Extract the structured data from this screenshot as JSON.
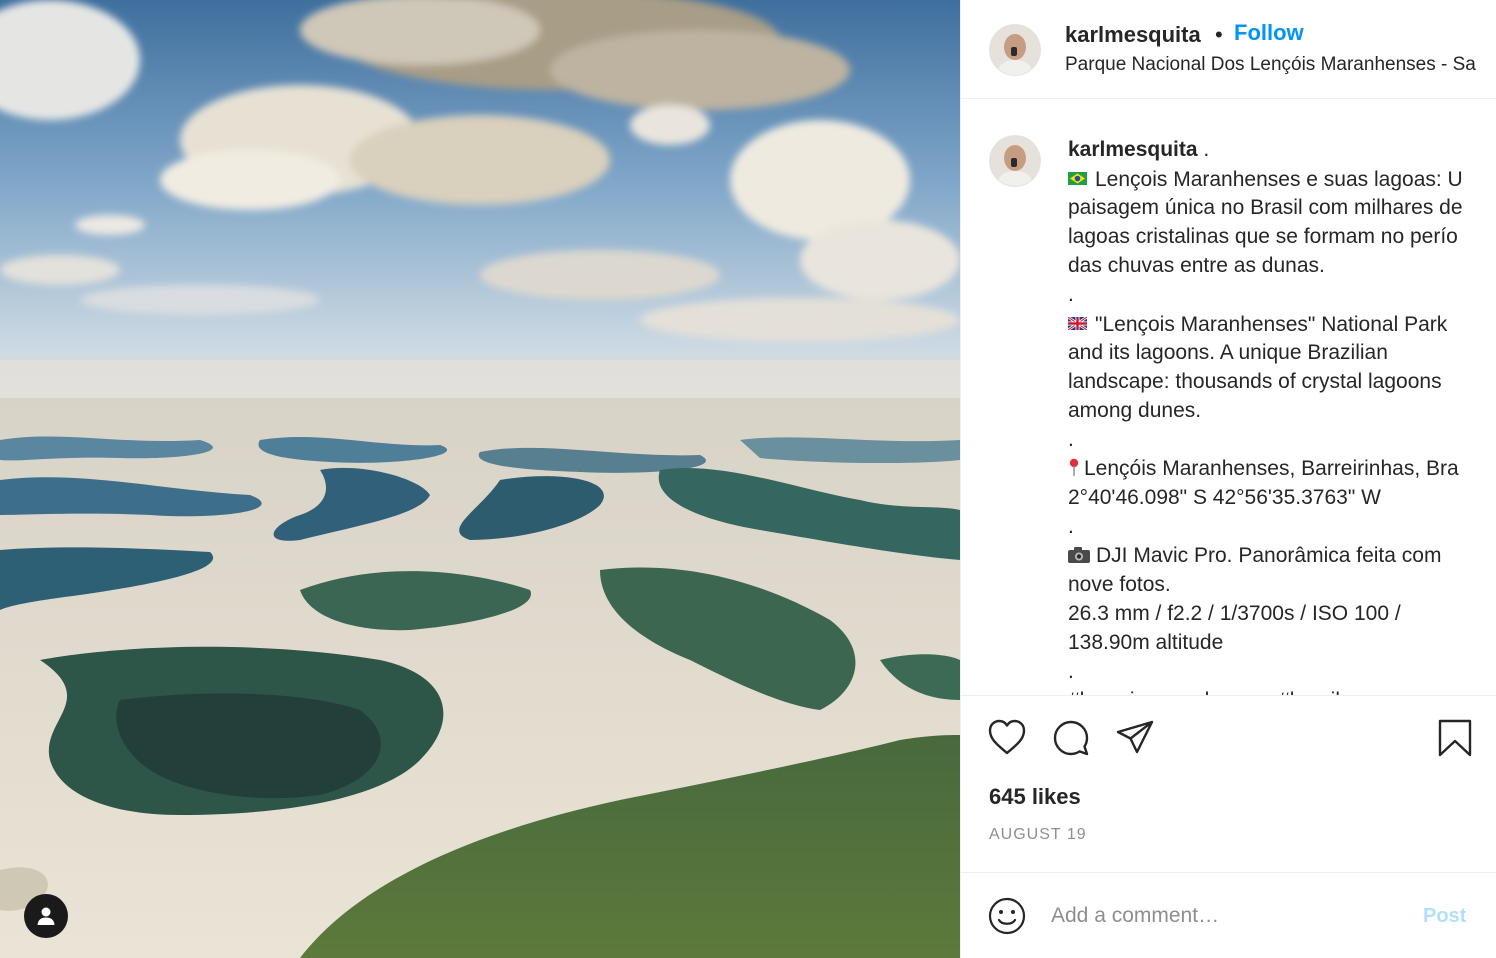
{
  "header": {
    "username": "karlmesquita",
    "separator": "•",
    "follow_label": "Follow",
    "location": "Parque Nacional Dos Lençóis Maranhenses - Sa"
  },
  "caption": {
    "username": "karlmesquita",
    "username_suffix": " .",
    "lines": [
      "Lençois Maranhenses e suas lagoas: U",
      "paisagem única no Brasil com milhares de",
      "lagoas cristalinas que se formam no perío",
      "das chuvas entre as dunas.",
      ".",
      "\"Lençois Maranhenses\" National Park",
      "and its lagoons. A unique Brazilian",
      "landscape: thousands of crystal lagoons",
      "among dunes.",
      ".",
      "Lençóis Maranhenses, Barreirinhas, Bra",
      "2°40'46.098\" S 42°56'35.3763\" W",
      ".",
      "DJI Mavic Pro. Panorâmica feita com",
      "nove fotos.",
      "26.3 mm / f2.2  / 1/3700s / ISO 100 /",
      "138.90m altitude",
      ".",
      "#lencoismaranhenses #brasil"
    ],
    "emojis": {
      "brazil_flag": "brazil-flag-icon",
      "uk_flag": "uk-flag-icon",
      "pin": "round-pushpin-icon",
      "camera": "camera-icon"
    }
  },
  "actions": {
    "like": "heart-icon",
    "comment": "comment-bubble-icon",
    "share": "paper-plane-icon",
    "save": "bookmark-icon"
  },
  "likes_label": "645 likes",
  "date_label": "AUGUST 19",
  "comment": {
    "placeholder": "Add a comment…",
    "post_label": "Post",
    "emoji_icon": "smiley-face-icon"
  },
  "colors": {
    "link_blue": "#0095f6",
    "post_disabled": "#b2dffc",
    "muted": "#8e8e8e",
    "text": "#262626"
  }
}
